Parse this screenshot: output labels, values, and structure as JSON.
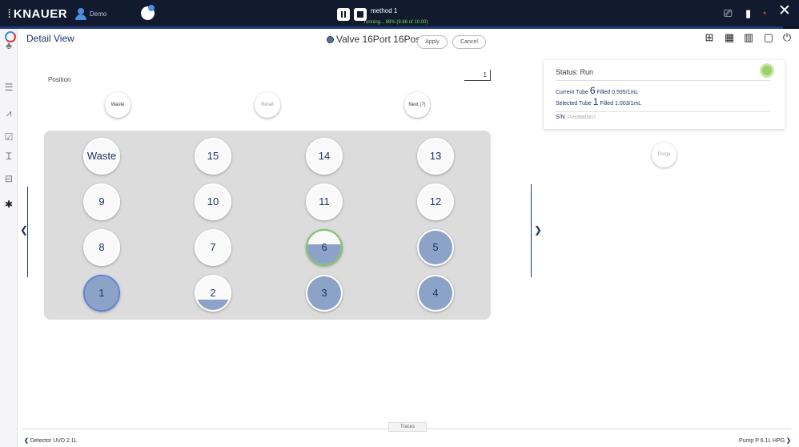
{
  "topbar": {
    "brand": "KNAUER",
    "user": "Demo",
    "method": "method 1",
    "progress_text": "running... 98% (9.86 of 10.00)",
    "progress_fraction": 0.98
  },
  "header": {
    "title": "Detail View",
    "valve": "Valve 16Port 16Pos",
    "apply": "Apply",
    "cancel": "Cancel"
  },
  "position": {
    "label": "Position",
    "value": "1",
    "waste_btn": "Waste",
    "reset_btn": "Reset",
    "next_btn": "Next (7)"
  },
  "tubes": [
    {
      "label": "Waste",
      "fill": 0
    },
    {
      "label": "15",
      "fill": 0
    },
    {
      "label": "14",
      "fill": 0
    },
    {
      "label": "13",
      "fill": 0
    },
    {
      "label": "9",
      "fill": 0
    },
    {
      "label": "10",
      "fill": 0
    },
    {
      "label": "11",
      "fill": 0
    },
    {
      "label": "12",
      "fill": 0
    },
    {
      "label": "8",
      "fill": 0
    },
    {
      "label": "7",
      "fill": 0
    },
    {
      "label": "6",
      "fill": 0.595,
      "state": "current"
    },
    {
      "label": "5",
      "fill": 1
    },
    {
      "label": "1",
      "fill": 1,
      "state": "selected"
    },
    {
      "label": "2",
      "fill": 0.3
    },
    {
      "label": "3",
      "fill": 1
    },
    {
      "label": "4",
      "fill": 1
    }
  ],
  "status": {
    "label": "Status: Run",
    "current_prefix": "Current Tube",
    "current_tube": "6",
    "current_fill": "Filled 0.595/1mL",
    "selected_prefix": "Selected Tube",
    "selected_tube": "1",
    "selected_fill": "Filled 1.003/1mL",
    "sn_label": "S/N",
    "sn_value": "FVH200810017",
    "purge": "Purge"
  },
  "footer": {
    "traces": "Traces",
    "left": "Detector UVD 2.1L",
    "right": "Pump P 6.1L HPG"
  },
  "colors": {
    "topbar": "#111a2e",
    "accent": "#1d3366",
    "fill": "#8da2c7",
    "status_ok": "#9bd16b"
  }
}
